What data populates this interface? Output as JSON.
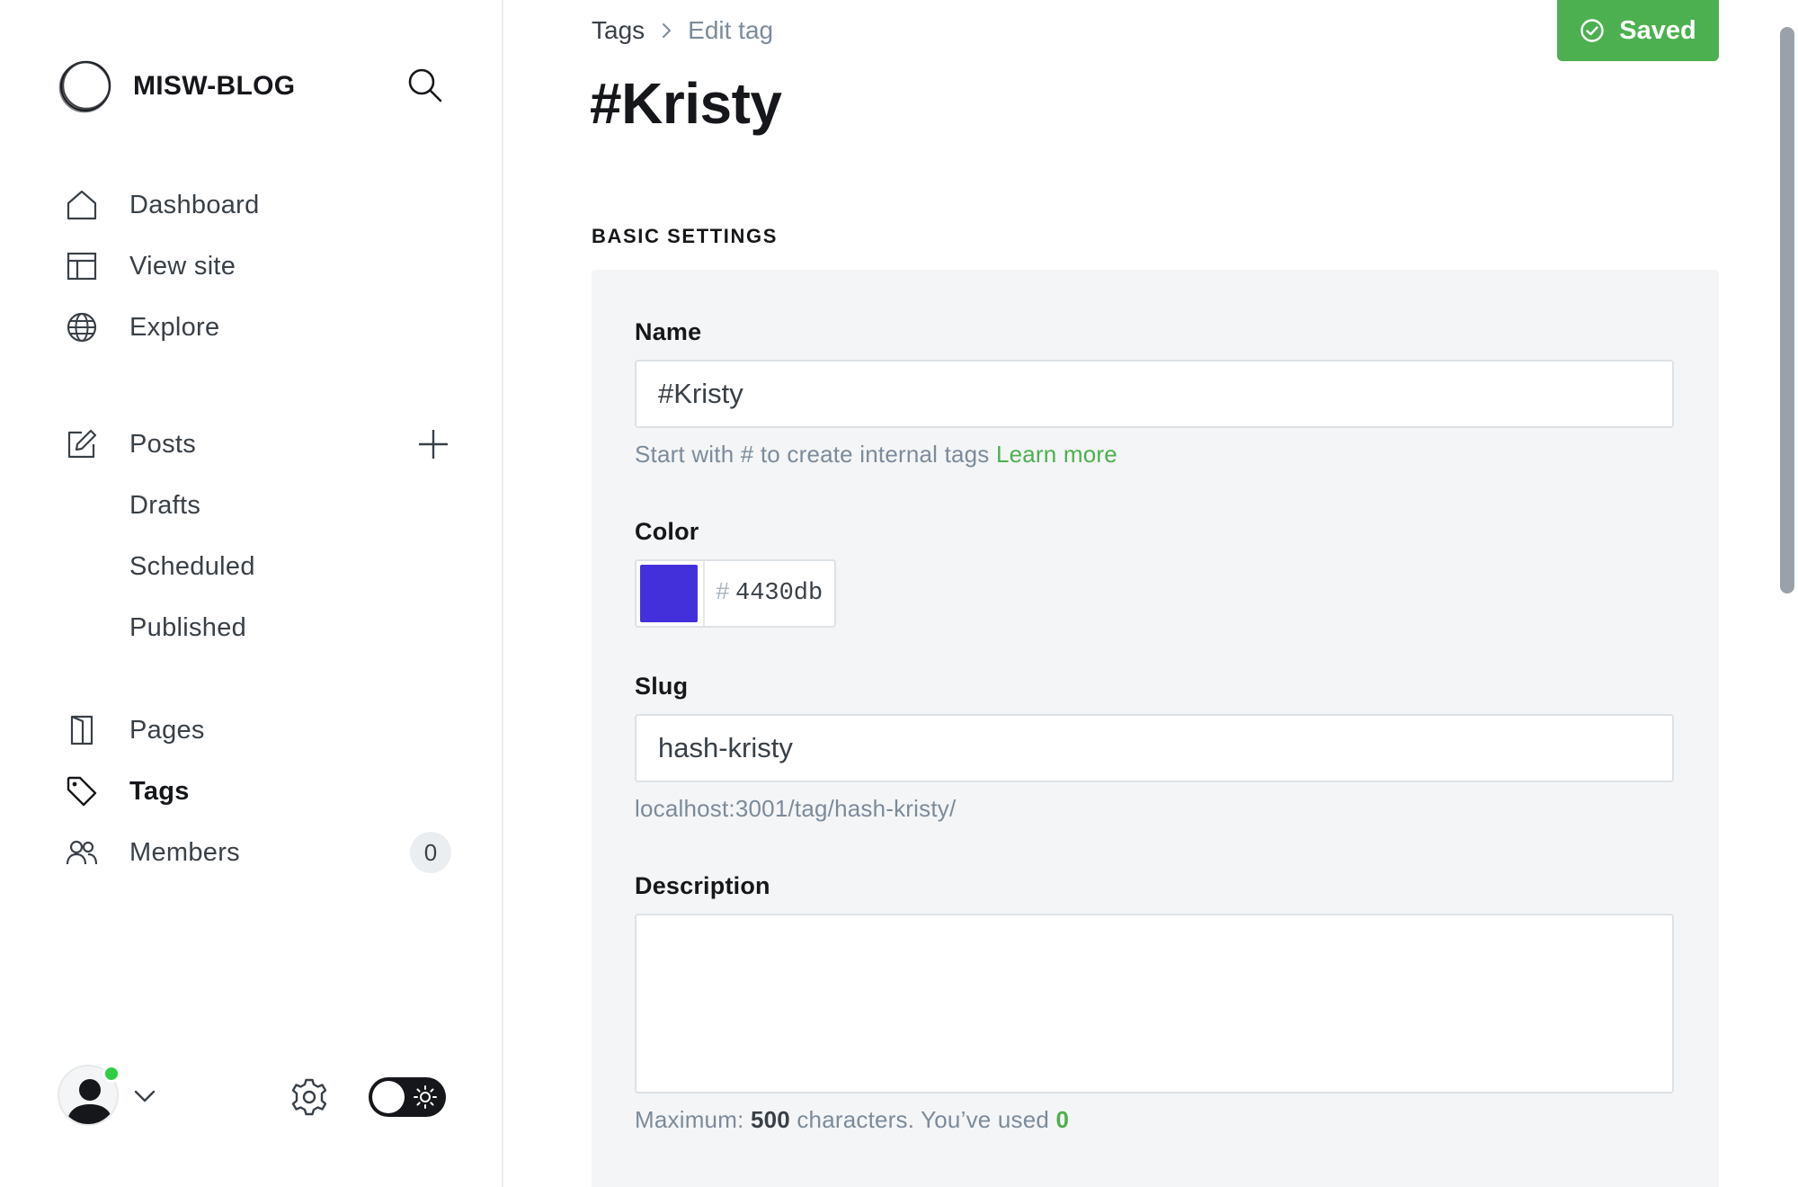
{
  "sidebar": {
    "brand": "MISW-BLOG",
    "nav_top": [
      {
        "label": "Dashboard"
      },
      {
        "label": "View site"
      },
      {
        "label": "Explore"
      }
    ],
    "posts": {
      "label": "Posts",
      "sub": [
        "Drafts",
        "Scheduled",
        "Published"
      ]
    },
    "nav_bottom": [
      {
        "label": "Pages"
      },
      {
        "label": "Tags"
      },
      {
        "label": "Members",
        "badge": "0"
      }
    ]
  },
  "header": {
    "crumb_root": "Tags",
    "crumb_current": "Edit tag",
    "saved_label": "Saved",
    "title": "#Kristy"
  },
  "form": {
    "section": "BASIC SETTINGS",
    "name_label": "Name",
    "name_value": "#Kristy",
    "name_hint": "Start with # to create internal tags",
    "learn_more": "Learn more",
    "color_label": "Color",
    "color_hash": "#",
    "color_value": "4430db",
    "color_hex": "#4430db",
    "slug_label": "Slug",
    "slug_value": "hash-kristy",
    "slug_url": "localhost:3001/tag/hash-kristy/",
    "desc_label": "Description",
    "desc_value": "",
    "desc_hint_prefix": "Maximum:",
    "desc_max": "500",
    "desc_hint_mid": "characters. You’ve used",
    "desc_used": "0"
  },
  "colors": {
    "accent_green": "#4cb050",
    "swatch": "#4430db",
    "panel_bg": "#f4f5f6"
  }
}
